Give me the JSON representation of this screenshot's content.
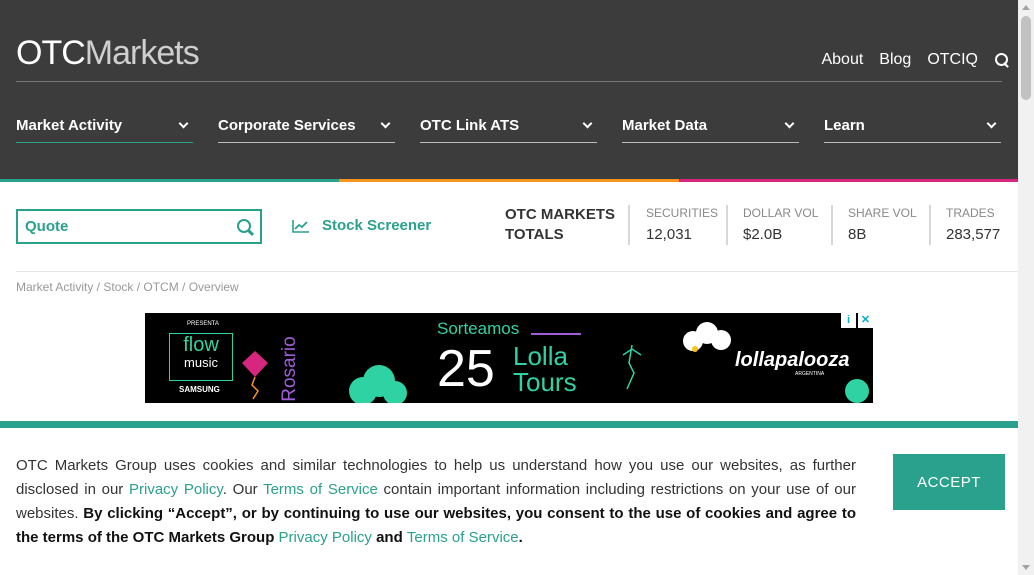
{
  "logo": {
    "part1": "OTC",
    "part2": "Markets"
  },
  "toplinks": [
    "About",
    "Blog",
    "OTCIQ"
  ],
  "nav": [
    {
      "label": "Market Activity"
    },
    {
      "label": "Corporate Services"
    },
    {
      "label": "OTC Link ATS"
    },
    {
      "label": "Market Data"
    },
    {
      "label": "Learn"
    }
  ],
  "colorbar": [
    "#2aa18d",
    "#f7941d",
    "#d7267f"
  ],
  "quote": {
    "placeholder": "Quote"
  },
  "screener": {
    "label": "Stock Screener"
  },
  "totals": {
    "line1": "OTC MARKETS",
    "line2": "TOTALS"
  },
  "stats": [
    {
      "label": "SECURITIES",
      "value": "12,031"
    },
    {
      "label": "DOLLAR VOL",
      "value": "$2.0B"
    },
    {
      "label": "SHARE VOL",
      "value": "8B"
    },
    {
      "label": "TRADES",
      "value": "283,577"
    }
  ],
  "breadcrumb": "Market Activity / Stock / OTCM / Overview",
  "ad": {
    "presenta": "PRESENTA",
    "flow": "flow",
    "music": "music",
    "samsung": "SAMSUNG",
    "rosario": "Rosario",
    "sorteamos": "Sorteamos",
    "number": "25",
    "lolla": "Lolla",
    "tours": "Tours",
    "brand": "lollapalooza",
    "brand_sub": "ARGENTINA"
  },
  "cookie": {
    "t1": "OTC Markets Group uses cookies and similar technologies to help us understand how you use our websites, as further disclosed in our ",
    "link1": "Privacy Policy",
    "t2": ". Our ",
    "link2": "Terms of Service",
    "t3": " contain important information including restrictions on your use of our websites. ",
    "bold1": "By clicking “Accept”, or by continuing to use our websites, you consent to the use of cookies and agree to the terms of the OTC Markets Group ",
    "link3": "Privacy Policy",
    "bold2": " and ",
    "link4": "Terms of Service",
    "bold3": ".",
    "accept": "ACCEPT"
  }
}
